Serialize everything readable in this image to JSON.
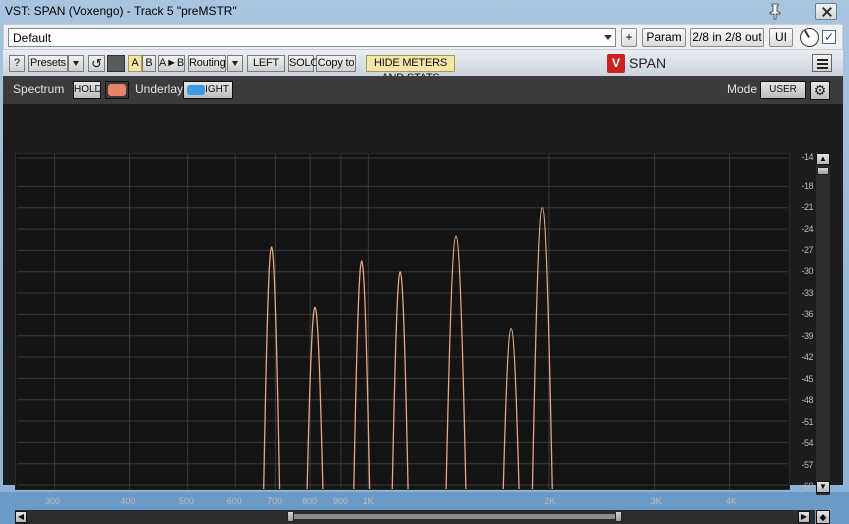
{
  "window": {
    "title": "VST: SPAN (Voxengo) - Track 5 \"preMSTR\""
  },
  "host": {
    "preset_value": "Default",
    "add_label": "+",
    "param_label": "Param",
    "io_label": "2/8 in 2/8 out",
    "ui_label": "UI",
    "checkbox_mark": "✓"
  },
  "toolbar": {
    "help_label": "?",
    "presets_label": "Presets",
    "undo_glyph": "↺",
    "a_label": "A",
    "b_label": "B",
    "ab_label": "A►B",
    "routing_label": "Routing",
    "left_label": "LEFT",
    "solo_label": "SOLO",
    "copyto_label": "Copy to",
    "hide_label": "HIDE METERS AND STATS",
    "logo_text": "V",
    "brand": "SPAN"
  },
  "controls": {
    "spectrum_label": "Spectrum",
    "hold_label": "HOLD",
    "underlay_label": "Underlay",
    "right_label": "RIGHT",
    "mode_label": "Mode",
    "mode_value": "USER",
    "hold_color": "#e8836a",
    "right_color": "#3b9ae0",
    "gear_glyph": "⚙"
  },
  "axis": {
    "x_ticks": [
      {
        "label": "300",
        "hz": 300
      },
      {
        "label": "400",
        "hz": 400
      },
      {
        "label": "500",
        "hz": 500
      },
      {
        "label": "600",
        "hz": 600
      },
      {
        "label": "700",
        "hz": 700
      },
      {
        "label": "800",
        "hz": 800
      },
      {
        "label": "900",
        "hz": 900
      },
      {
        "label": "1K",
        "hz": 1000
      },
      {
        "label": "2K",
        "hz": 2000
      },
      {
        "label": "3K",
        "hz": 3000
      },
      {
        "label": "4K",
        "hz": 4000
      }
    ],
    "y_ticks": [
      "-14",
      "-18",
      "-21",
      "-24",
      "-27",
      "-30",
      "-33",
      "-36",
      "-39",
      "-42",
      "-45",
      "-48",
      "-51",
      "-54",
      "-57",
      "-60"
    ],
    "x_range_hz": [
      260,
      5000
    ],
    "y_range_db": [
      -14,
      -60
    ],
    "line_color": "#e8a882"
  },
  "chart_data": {
    "type": "line",
    "xlabel": "",
    "ylabel": "",
    "x_scale": "log",
    "xlim": [
      260,
      5000
    ],
    "ylim": [
      -60,
      -14
    ],
    "series": [
      {
        "peaks_hz": [
          690,
          815,
          975,
          1130,
          1400,
          1730,
          1950
        ],
        "peaks_db": [
          -26.5,
          -35,
          -28.5,
          -30,
          -25,
          -38,
          -21
        ]
      }
    ]
  }
}
